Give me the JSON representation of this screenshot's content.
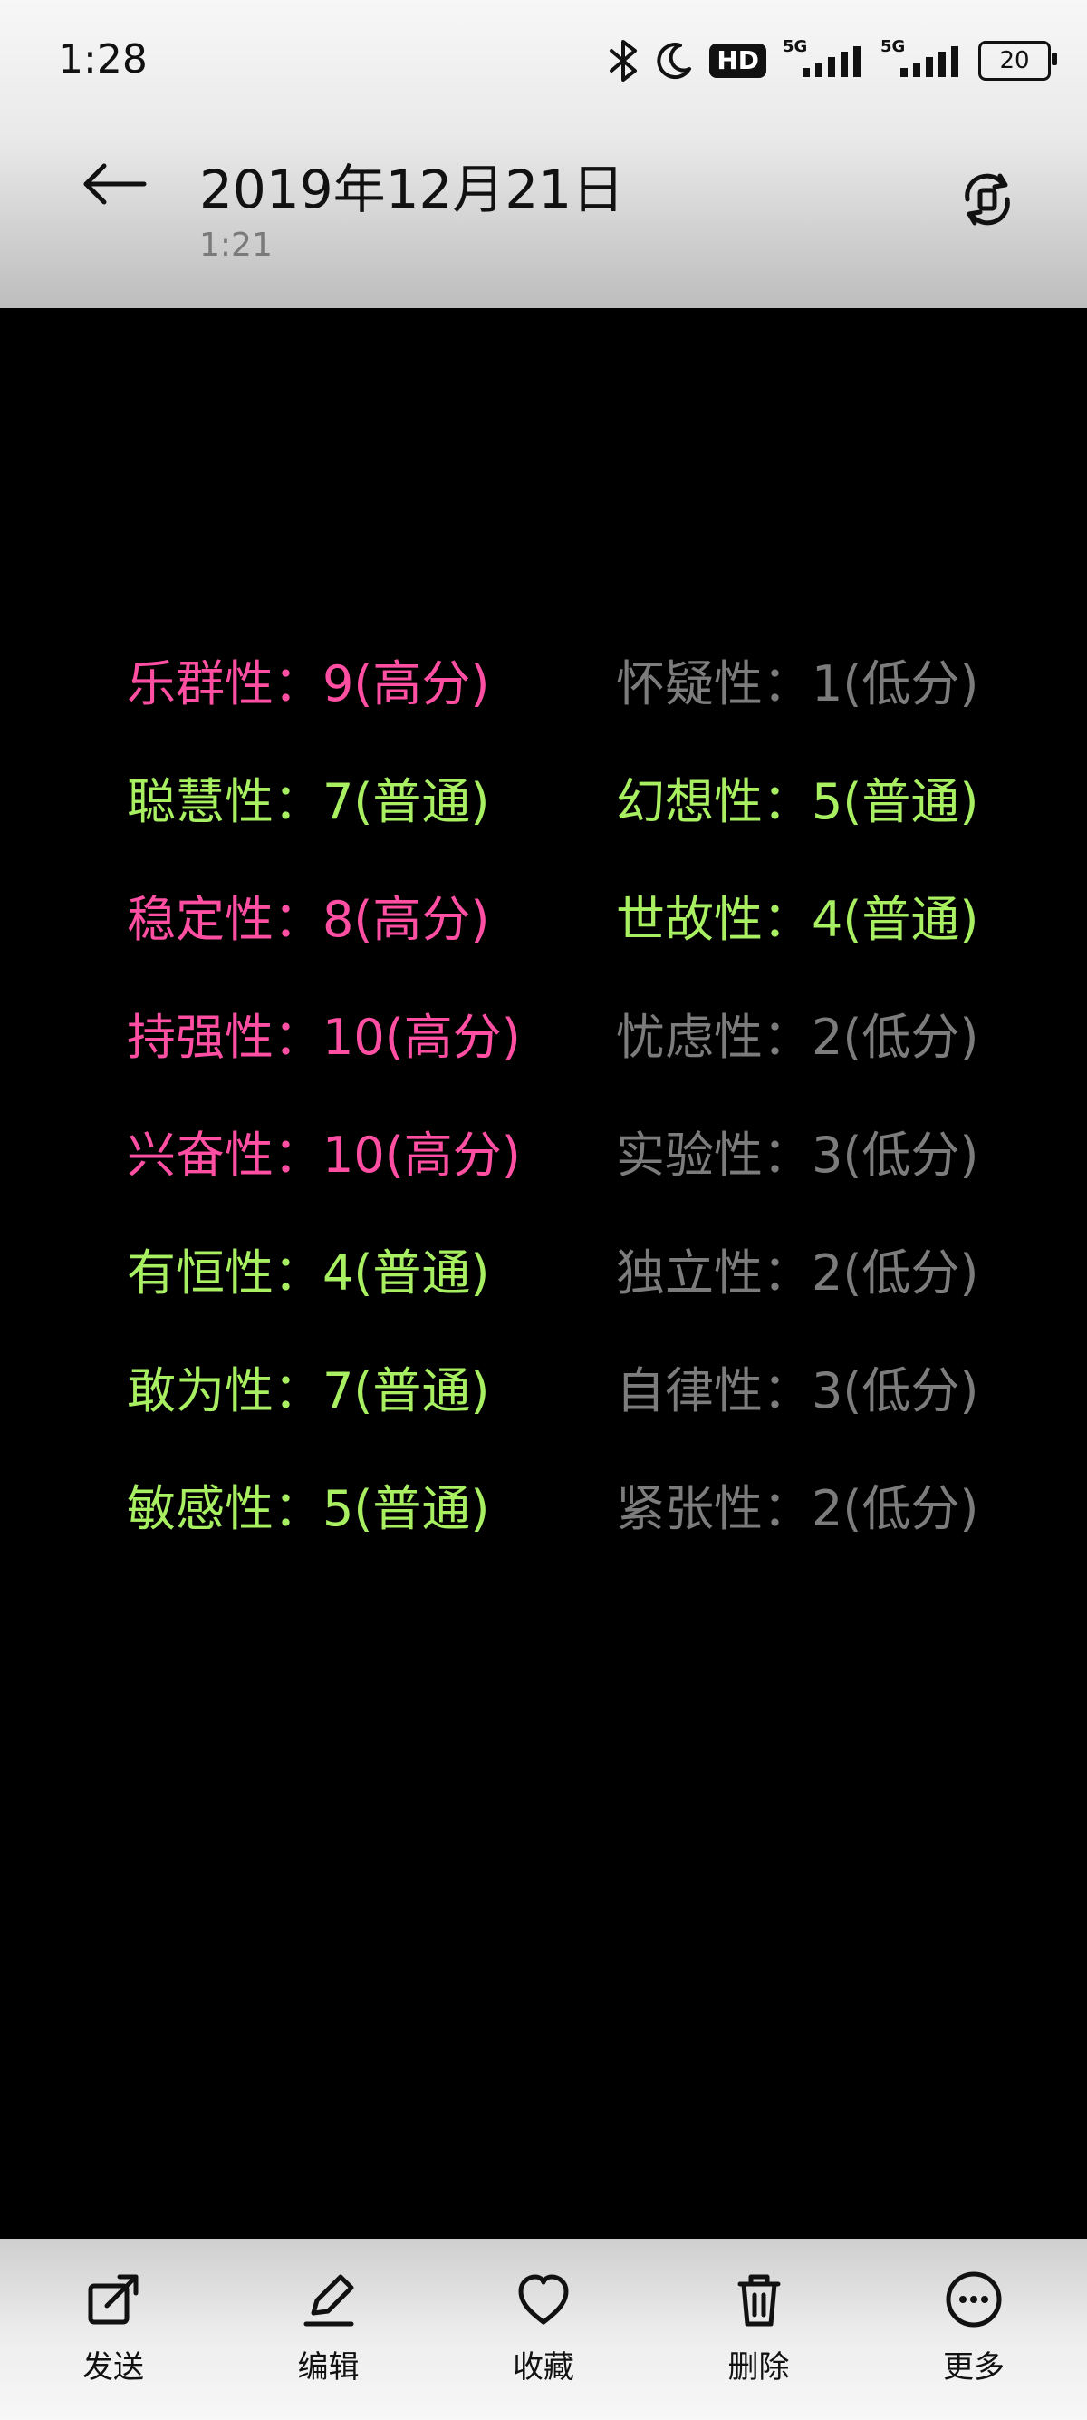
{
  "status_bar": {
    "time": "1:28",
    "hd_label": "HD",
    "net_label_1": "5G",
    "net_label_2": "5G",
    "battery_level": "20",
    "icons": [
      "bluetooth-icon",
      "do-not-disturb-moon-icon",
      "signal-bars-icon",
      "signal-bars-icon",
      "battery-icon"
    ]
  },
  "header": {
    "back_icon": "arrow-left-icon",
    "title": "2019年12月21日",
    "subtitle": "1:21",
    "rotate_icon": "rotate-screen-icon"
  },
  "traits": {
    "left": [
      {
        "text": "乐群性：9(高分)",
        "level": "high"
      },
      {
        "text": "聪慧性：7(普通)",
        "level": "normal"
      },
      {
        "text": "稳定性：8(高分)",
        "level": "high"
      },
      {
        "text": "持强性：10(高分)",
        "level": "high"
      },
      {
        "text": "兴奋性：10(高分)",
        "level": "high"
      },
      {
        "text": "有恒性：4(普通)",
        "level": "normal"
      },
      {
        "text": "敢为性：7(普通)",
        "level": "normal"
      },
      {
        "text": "敏感性：5(普通)",
        "level": "normal"
      }
    ],
    "right": [
      {
        "text": "怀疑性：1(低分)",
        "level": "low"
      },
      {
        "text": "幻想性：5(普通)",
        "level": "normal"
      },
      {
        "text": "世故性：4(普通)",
        "level": "normal"
      },
      {
        "text": "忧虑性：2(低分)",
        "level": "low"
      },
      {
        "text": "实验性：3(低分)",
        "level": "low"
      },
      {
        "text": "独立性：2(低分)",
        "level": "low"
      },
      {
        "text": "自律性：3(低分)",
        "level": "low"
      },
      {
        "text": "紧张性：2(低分)",
        "level": "low"
      }
    ],
    "colors": {
      "high": "#ff4fa3",
      "normal": "#a8ef62",
      "low": "#7c7c7c"
    }
  },
  "bottom_actions": [
    {
      "label": "发送",
      "icon": "share-icon"
    },
    {
      "label": "编辑",
      "icon": "edit-pencil-icon"
    },
    {
      "label": "收藏",
      "icon": "heart-icon"
    },
    {
      "label": "删除",
      "icon": "trash-icon"
    },
    {
      "label": "更多",
      "icon": "more-dots-icon"
    }
  ]
}
